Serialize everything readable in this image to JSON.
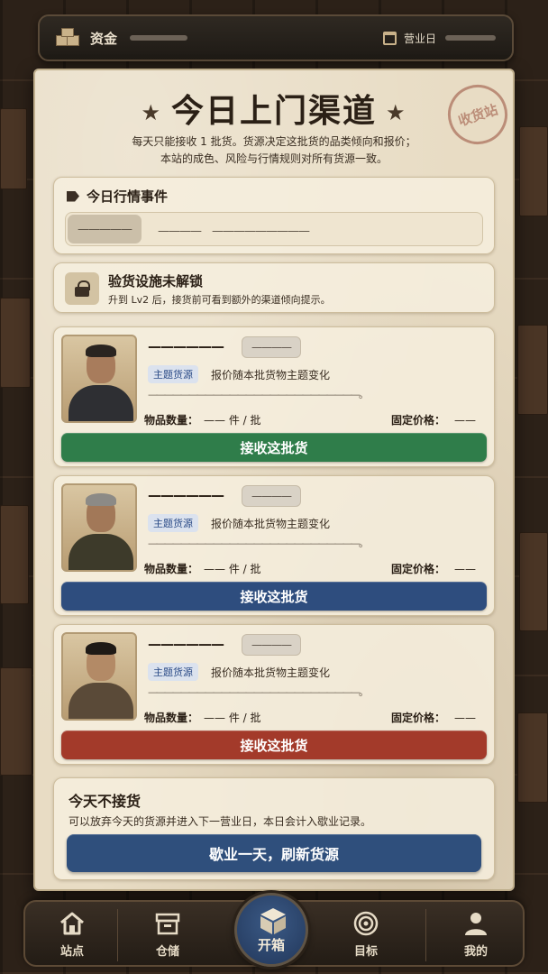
{
  "topbar": {
    "funds_label": "资金",
    "day_label": "营业日"
  },
  "panel": {
    "title": "今日上门渠道",
    "stamp": "收货站",
    "subtitle_line1": "每天只能接收 1 批货。货源决定这批货的品类倾向和报价；",
    "subtitle_line2": "本站的成色、风险与行情规则对所有货源一致。"
  },
  "event": {
    "title": "今日行情事件",
    "chip": "—————",
    "text": "————　—————————"
  },
  "lock": {
    "title": "验货设施未解锁",
    "desc": "升到 Lv2 后，接货前可看到额外的渠道倾向提示。"
  },
  "suppliers": [
    {
      "name": "——————",
      "chip": "————",
      "badge": "主题货源",
      "desc": "报价随本批货物主题变化",
      "line": "——————————————————————————。",
      "qty_label": "物品数量：",
      "qty_value": "—— 件 / 批",
      "price_label": "固定价格：",
      "price_value": "——",
      "button": "接收这批货",
      "button_color": "#2f7d4a"
    },
    {
      "name": "——————",
      "chip": "————",
      "badge": "主题货源",
      "desc": "报价随本批货物主题变化",
      "line": "——————————————————————————。",
      "qty_label": "物品数量：",
      "qty_value": "—— 件 / 批",
      "price_label": "固定价格：",
      "price_value": "——",
      "button": "接收这批货",
      "button_color": "#2e4d7e"
    },
    {
      "name": "——————",
      "chip": "————",
      "badge": "主题货源",
      "desc": "报价随本批货物主题变化",
      "line": "——————————————————————————。",
      "qty_label": "物品数量：",
      "qty_value": "—— 件 / 批",
      "price_label": "固定价格：",
      "price_value": "——",
      "button": "接收这批货",
      "button_color": "#a33a2a"
    }
  ],
  "skip": {
    "title": "今天不接货",
    "desc": "可以放弃今天的货源并进入下一营业日，本日会计入歇业记录。",
    "button": "歇业一天，刷新货源"
  },
  "nav": {
    "station": "站点",
    "storage": "仓储",
    "open_box": "开箱",
    "goals": "目标",
    "mine": "我的"
  }
}
